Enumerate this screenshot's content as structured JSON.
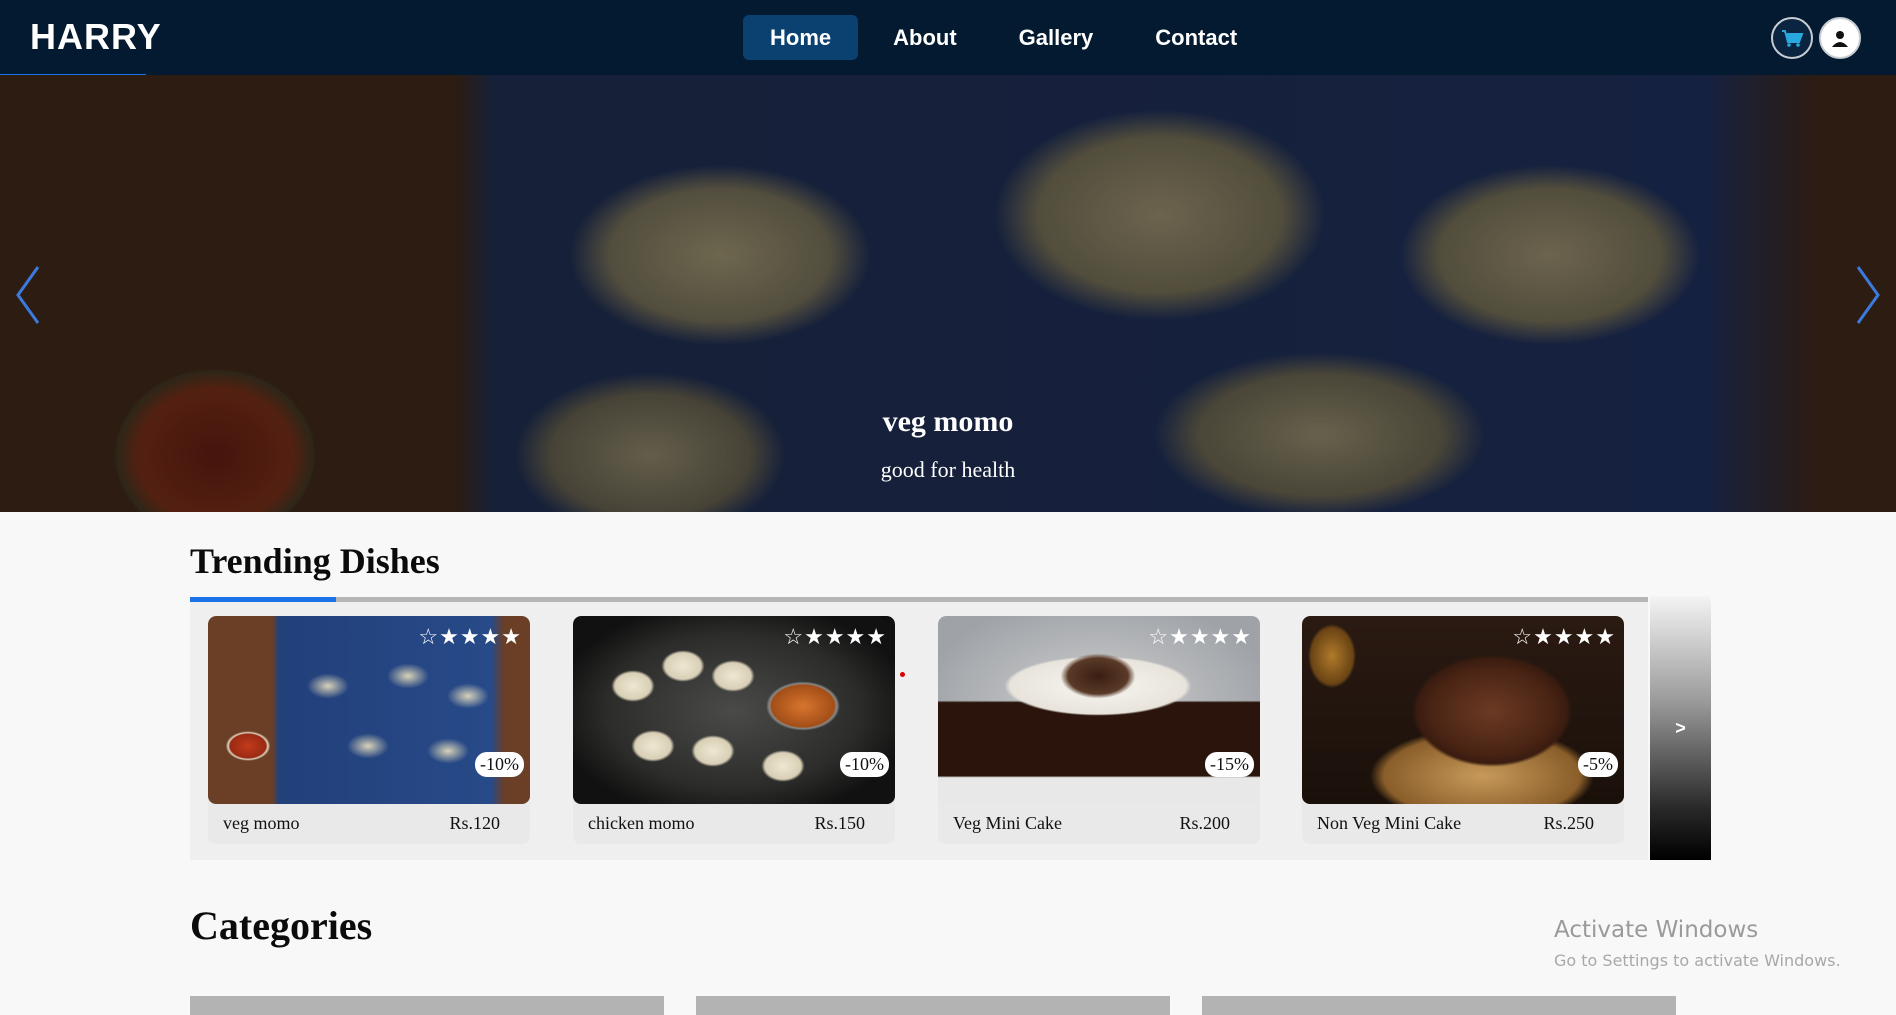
{
  "navbar": {
    "brand": "HARRY",
    "links": [
      {
        "label": "Home",
        "active": true
      },
      {
        "label": "About",
        "active": false
      },
      {
        "label": "Gallery",
        "active": false
      },
      {
        "label": "Contact",
        "active": false
      }
    ],
    "icons": [
      "cart-icon",
      "user-icon"
    ]
  },
  "hero": {
    "title": "veg momo",
    "subtitle": "good for health"
  },
  "trending": {
    "title": "Trending Dishes",
    "next_label": ">",
    "cards": [
      {
        "name": "veg momo",
        "price": "Rs.120",
        "discount": "-10%",
        "stars": "☆★★★★"
      },
      {
        "name": "chicken momo",
        "price": "Rs.150",
        "discount": "-10%",
        "stars": "☆★★★★"
      },
      {
        "name": "Veg Mini Cake",
        "price": "Rs.200",
        "discount": "-15%",
        "stars": "☆★★★★"
      },
      {
        "name": "Non Veg Mini Cake",
        "price": "Rs.250",
        "discount": "-5%",
        "stars": "☆★★★★"
      }
    ]
  },
  "categories": {
    "title": "Categories"
  },
  "watermark": {
    "line1": "Activate Windows",
    "line2": "Go to Settings to activate Windows."
  },
  "colors": {
    "navbar_bg": "#031a30",
    "accent": "#1a73e8",
    "active_nav": "#0a4170"
  }
}
